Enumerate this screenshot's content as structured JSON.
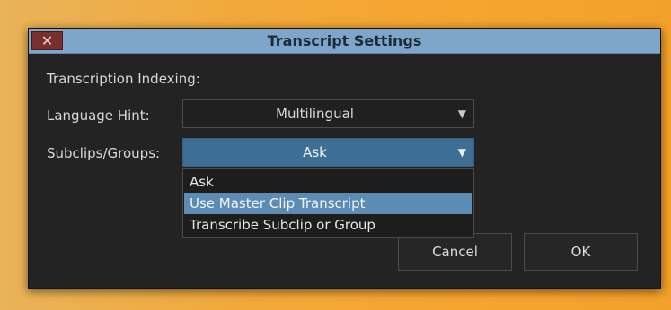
{
  "window": {
    "title": "Transcript Settings",
    "close_glyph": "✕"
  },
  "form": {
    "section_heading": "Transcription Indexing:",
    "language_hint": {
      "label": "Language Hint:",
      "value": "Multilingual"
    },
    "subclips_groups": {
      "label": "Subclips/Groups:",
      "value": "Ask",
      "options": [
        "Ask",
        "Use Master Clip Transcript",
        "Transcribe Subclip or Group"
      ],
      "highlighted_option": "Use Master Clip Transcript"
    }
  },
  "buttons": {
    "cancel": "Cancel",
    "ok": "OK"
  },
  "colors": {
    "titlebar": "#7ea6c9",
    "dialog_bg": "#232323",
    "selected_field": "#3f6e94",
    "highlight": "#5c8bb3",
    "close_button": "#7a2f2f"
  },
  "icons": [
    "close-icon",
    "chevron-down-icon"
  ]
}
